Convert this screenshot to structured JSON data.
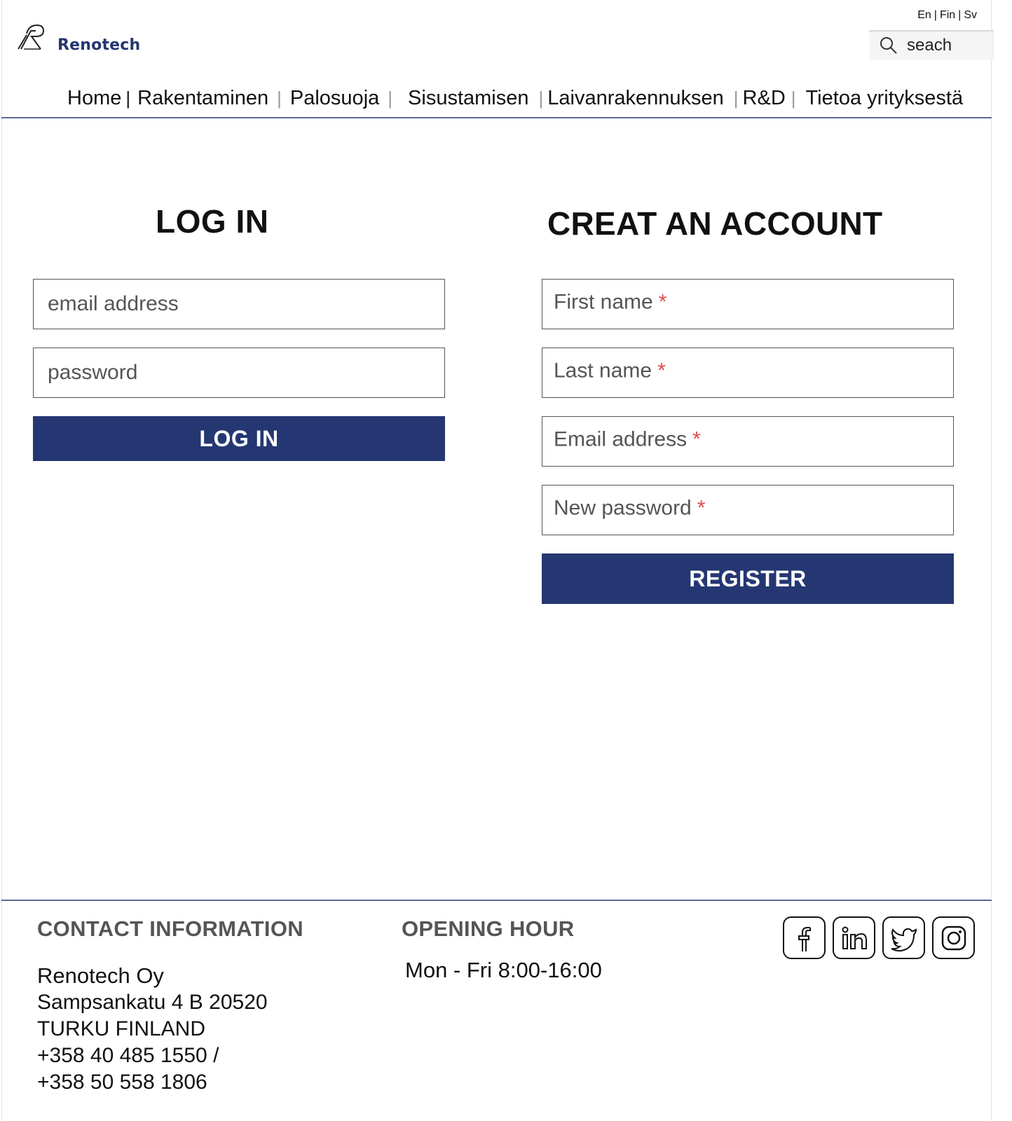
{
  "header": {
    "brand": "Renotech",
    "languages": [
      "En",
      "Fin",
      "Sv"
    ],
    "search": {
      "placeholder": "seach",
      "icon": "search-icon"
    }
  },
  "nav": {
    "items": [
      "Home",
      "Rakentaminen",
      "Palosuoja",
      "Sisustamisen",
      "Laivanrakennuksen",
      "R&D",
      "Tietoa yrityksestä"
    ]
  },
  "login": {
    "title": "LOG IN",
    "email_placeholder": "email address",
    "password_placeholder": "password",
    "button_label": "LOG IN"
  },
  "register": {
    "title": "CREAT AN ACCOUNT",
    "first_name_label": "First name",
    "last_name_label": "Last name",
    "email_label": "Email address",
    "password_label": "New password",
    "required_mark": "*",
    "button_label": "REGISTER"
  },
  "footer": {
    "contact_title": "CONTACT INFORMATION",
    "company": "Renotech Oy",
    "address_line1": "Sampsankatu 4 B 20520",
    "address_line2": "TURKU FINLAND",
    "phone1": "+358 40 485 1550 /",
    "phone2": "+358 50 558 1806",
    "opening_title": "OPENING HOUR",
    "opening_hours": "Mon - Fri  8:00-16:00",
    "social_icons": [
      "facebook-icon",
      "linkedin-icon",
      "twitter-icon",
      "instagram-icon"
    ]
  },
  "colors": {
    "brand": "#24366f",
    "button": "#253772",
    "required": "#e24b4b",
    "rule": "#5a6a9a"
  }
}
